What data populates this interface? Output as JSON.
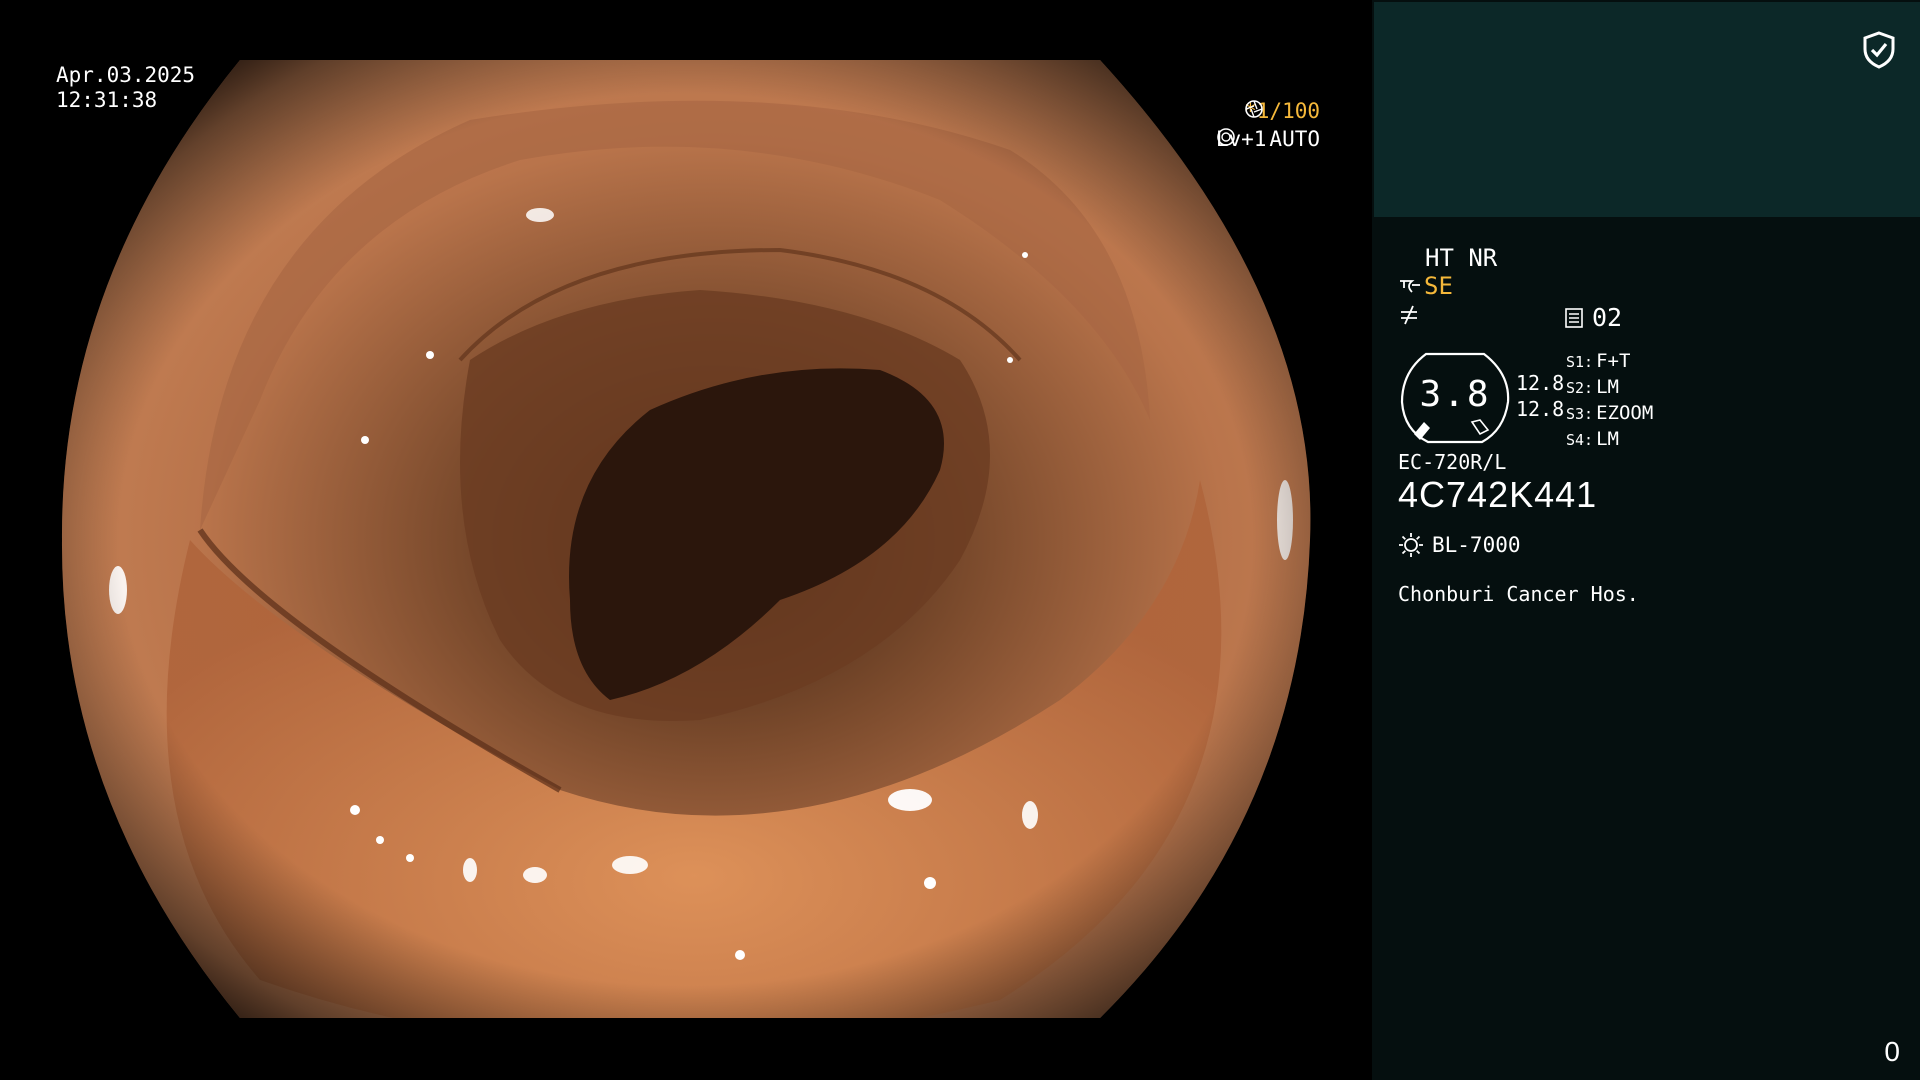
{
  "video": {
    "date": "Apr.03.2025",
    "time": "12:31:38",
    "zoom": "*1/100",
    "level": "Lv+1",
    "mode": "AUTO"
  },
  "panel": {
    "ht_nr": "HT NR",
    "se_value": "SE",
    "memo_value": "02",
    "gauge_value": "3.8",
    "ratio_1": "12.8",
    "ratio_2": "12.8",
    "slots": [
      {
        "key": "S1:",
        "value": "F+T"
      },
      {
        "key": "S2:",
        "value": "LM"
      },
      {
        "key": "S3:",
        "value": "EZOOM"
      },
      {
        "key": "S4:",
        "value": "LM"
      }
    ],
    "scope_model": "EC-720R/L",
    "serial": "4C742K441",
    "light_source": "BL-7000",
    "hospital": "Chonburi Cancer Hos.",
    "counter": "0"
  },
  "colors": {
    "accent_orange": "#f5b83a",
    "panel_bg": "#050f0f",
    "panel_top_bg": "#0c2828"
  },
  "icons": [
    "aperture-icon",
    "iris-icon",
    "shield-check-icon",
    "scope-icon",
    "no-rate-icon",
    "memo-icon",
    "light-source-icon"
  ]
}
